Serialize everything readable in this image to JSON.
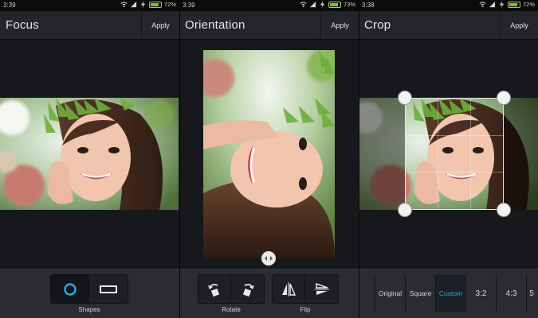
{
  "panels": {
    "focus": {
      "status": {
        "time": "3:39",
        "battery": "72%"
      },
      "title": "Focus",
      "apply_label": "Apply",
      "group_label": "Shapes",
      "tools": [
        "circle-shape-icon",
        "rectangle-shape-icon"
      ],
      "selected_tool": "circle-shape-icon"
    },
    "orientation": {
      "status": {
        "time": "3:39",
        "battery": "73%"
      },
      "title": "Orientation",
      "apply_label": "Apply",
      "rotate_label": "Rotate",
      "flip_label": "Flip",
      "tools": [
        "rotate-left-icon",
        "rotate-right-icon",
        "flip-horizontal-icon",
        "flip-vertical-icon"
      ]
    },
    "crop": {
      "status": {
        "time": "3:38",
        "battery": "72%"
      },
      "title": "Crop",
      "apply_label": "Apply",
      "tabs": [
        {
          "label": "Original"
        },
        {
          "label": "Square"
        },
        {
          "label": "Custom"
        },
        {
          "label": "3:2"
        },
        {
          "label": "4:3"
        },
        {
          "label": "5"
        }
      ],
      "active_tab": "Custom"
    }
  },
  "colors": {
    "accent": "#2aa6dd",
    "battery": "#7ac232",
    "toolbar": "#23252a",
    "bottombar": "#2a2c31"
  }
}
